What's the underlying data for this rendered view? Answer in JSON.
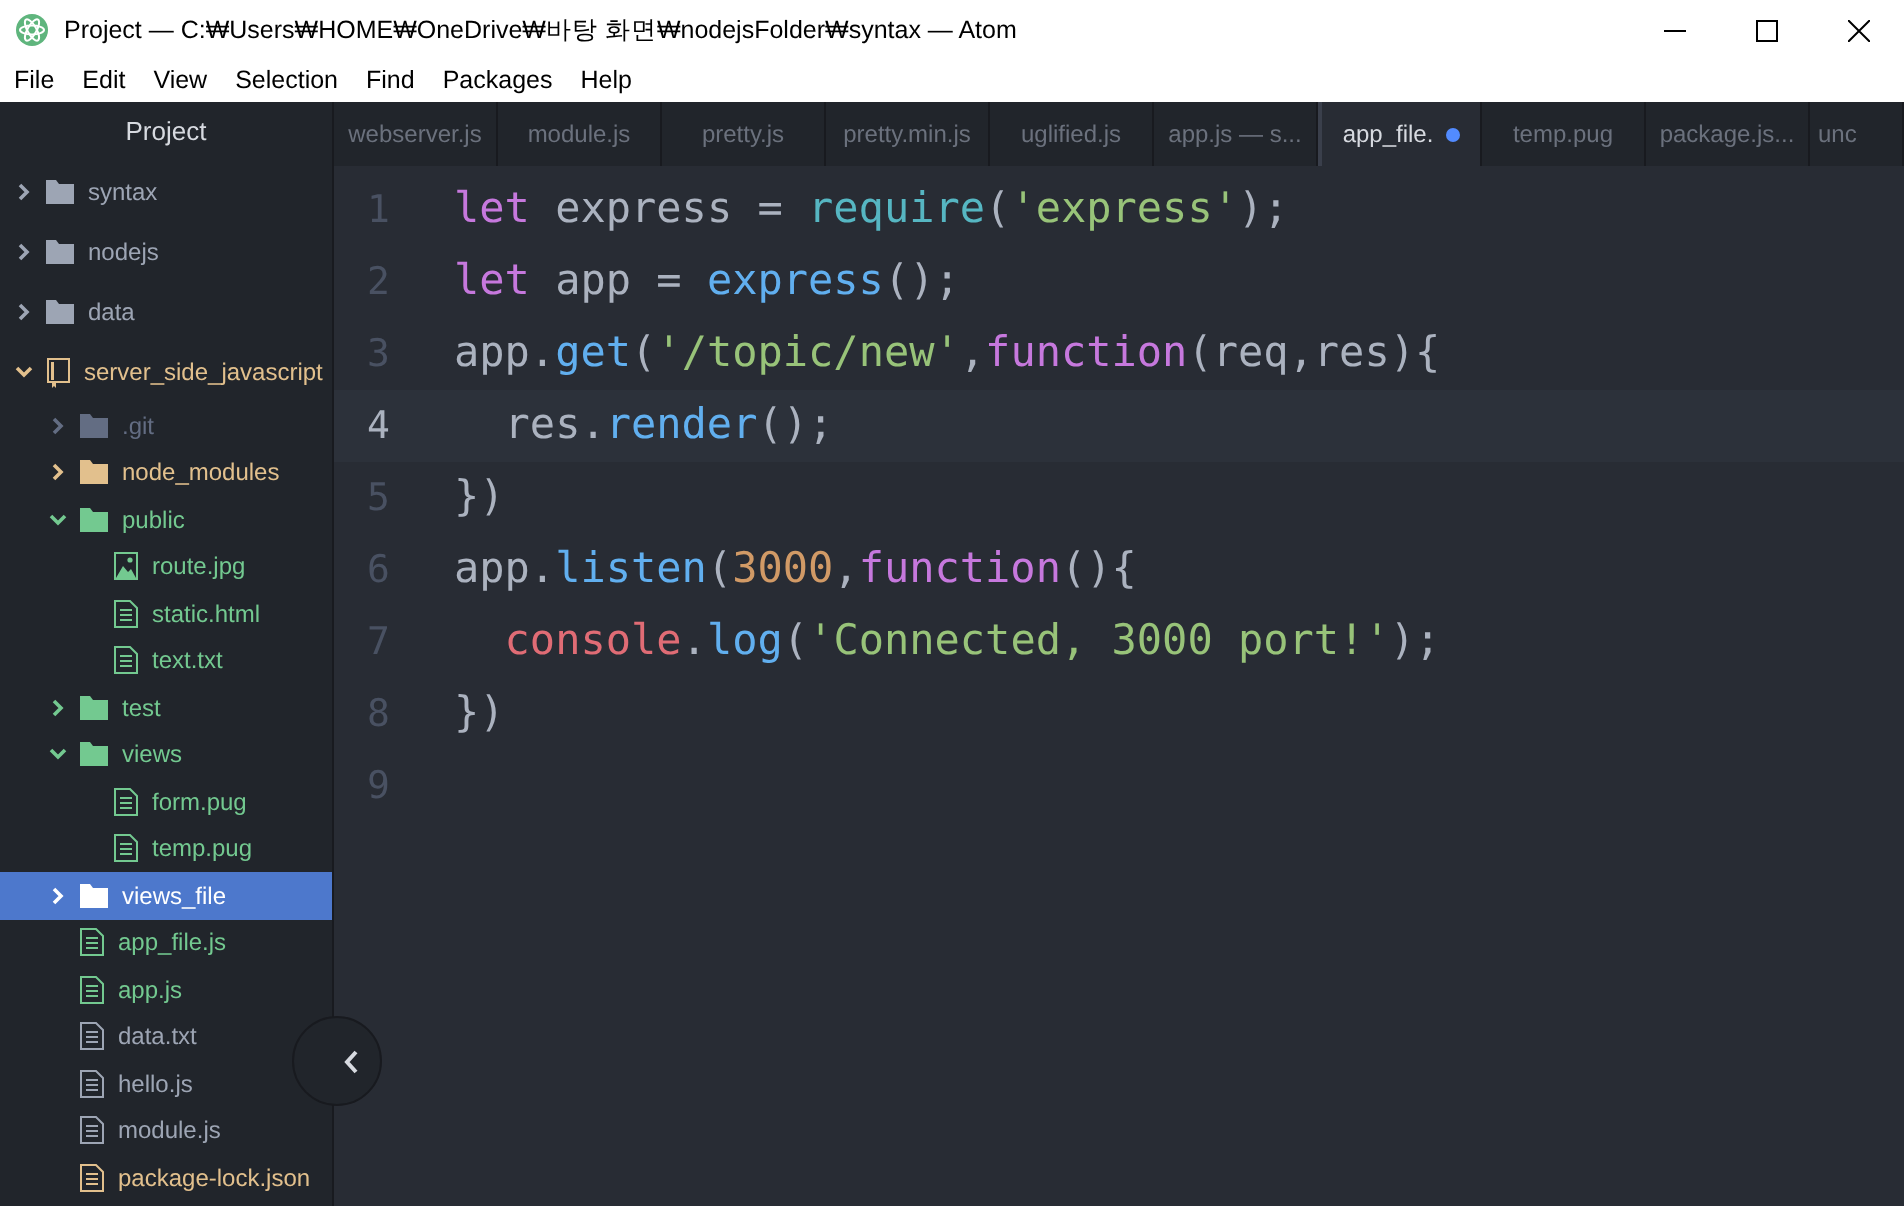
{
  "window": {
    "title": "Project — C:₩Users₩HOME₩OneDrive₩바탕 화면₩nodejsFolder₩syntax — Atom"
  },
  "menu": [
    "File",
    "Edit",
    "View",
    "Selection",
    "Find",
    "Packages",
    "Help"
  ],
  "tree_view": {
    "title": "Project",
    "items": [
      {
        "label": "syntax",
        "kind": "folder",
        "expanded": false,
        "selected": false
      },
      {
        "label": "nodejs",
        "kind": "folder",
        "expanded": false,
        "selected": false
      },
      {
        "label": "data",
        "kind": "folder",
        "expanded": false,
        "selected": false
      },
      {
        "label": "server_side_javascript",
        "kind": "repo",
        "expanded": true,
        "selected": false,
        "color": "#e2c08d",
        "children": [
          {
            "label": ".git",
            "kind": "folder",
            "expanded": false,
            "selected": false,
            "color": "#636d83"
          },
          {
            "label": "node_modules",
            "kind": "folder",
            "expanded": false,
            "selected": false,
            "color": "#e2c08d"
          },
          {
            "label": "public",
            "kind": "folder",
            "expanded": true,
            "selected": false,
            "color": "#73c990",
            "children": [
              {
                "label": "route.jpg",
                "kind": "image",
                "selected": false,
                "color": "#73c990"
              },
              {
                "label": "static.html",
                "kind": "file",
                "selected": false,
                "color": "#73c990"
              },
              {
                "label": "text.txt",
                "kind": "file",
                "selected": false,
                "color": "#73c990"
              }
            ]
          },
          {
            "label": "test",
            "kind": "folder",
            "expanded": false,
            "selected": false,
            "color": "#73c990"
          },
          {
            "label": "views",
            "kind": "folder",
            "expanded": true,
            "selected": false,
            "color": "#73c990",
            "children": [
              {
                "label": "form.pug",
                "kind": "file",
                "selected": false,
                "color": "#73c990"
              },
              {
                "label": "temp.pug",
                "kind": "file",
                "selected": false,
                "color": "#73c990"
              }
            ]
          },
          {
            "label": "views_file",
            "kind": "folder",
            "expanded": false,
            "selected": true
          },
          {
            "label": "app_file.js",
            "kind": "file",
            "selected": false,
            "color": "#73c990"
          },
          {
            "label": "app.js",
            "kind": "file",
            "selected": false,
            "color": "#73c990"
          },
          {
            "label": "data.txt",
            "kind": "file",
            "selected": false
          },
          {
            "label": "hello.js",
            "kind": "file",
            "selected": false
          },
          {
            "label": "module.js",
            "kind": "file",
            "selected": false
          },
          {
            "label": "package-lock.json",
            "kind": "file",
            "selected": false,
            "color": "#e2c08d"
          }
        ]
      }
    ]
  },
  "tabs": [
    {
      "label": "webserver.js",
      "selected": false,
      "modified": false
    },
    {
      "label": "module.js",
      "selected": false,
      "modified": false
    },
    {
      "label": "pretty.js",
      "selected": false,
      "modified": false
    },
    {
      "label": "pretty.min.js",
      "selected": false,
      "modified": false
    },
    {
      "label": "uglified.js",
      "selected": false,
      "modified": false
    },
    {
      "label": "app.js — s...",
      "selected": false,
      "modified": false
    },
    {
      "label": "app_file.",
      "selected": true,
      "modified": true
    },
    {
      "label": "temp.pug",
      "selected": false,
      "modified": false
    },
    {
      "label": "package.js...",
      "selected": false,
      "modified": false
    },
    {
      "label": "unc",
      "selected": false,
      "modified": false
    }
  ],
  "editor": {
    "lines": [
      {
        "number": "1",
        "current": false,
        "tokens": [
          {
            "text": "let",
            "kind": "keyword"
          },
          {
            "text": " express = ",
            "kind": "plain"
          },
          {
            "text": "require",
            "kind": "support"
          },
          {
            "text": "(",
            "kind": "plain"
          },
          {
            "text": "'express'",
            "kind": "string"
          },
          {
            "text": ");",
            "kind": "plain"
          }
        ]
      },
      {
        "number": "2",
        "current": false,
        "tokens": [
          {
            "text": "let",
            "kind": "keyword"
          },
          {
            "text": " app = ",
            "kind": "plain"
          },
          {
            "text": "express",
            "kind": "function"
          },
          {
            "text": "();",
            "kind": "plain"
          }
        ]
      },
      {
        "number": "3",
        "current": false,
        "tokens": [
          {
            "text": "app.",
            "kind": "plain"
          },
          {
            "text": "get",
            "kind": "function"
          },
          {
            "text": "(",
            "kind": "plain"
          },
          {
            "text": "'/topic/new'",
            "kind": "string"
          },
          {
            "text": ",",
            "kind": "plain"
          },
          {
            "text": "function",
            "kind": "keyword"
          },
          {
            "text": "(req,res){",
            "kind": "plain"
          }
        ]
      },
      {
        "number": "4",
        "current": true,
        "tokens": [
          {
            "text": "  res.",
            "kind": "plain"
          },
          {
            "text": "render",
            "kind": "function"
          },
          {
            "text": "();",
            "kind": "plain"
          }
        ]
      },
      {
        "number": "5",
        "current": false,
        "tokens": [
          {
            "text": "})",
            "kind": "plain"
          }
        ]
      },
      {
        "number": "6",
        "current": false,
        "tokens": [
          {
            "text": "app.",
            "kind": "plain"
          },
          {
            "text": "listen",
            "kind": "function"
          },
          {
            "text": "(",
            "kind": "plain"
          },
          {
            "text": "3000",
            "kind": "number"
          },
          {
            "text": ",",
            "kind": "plain"
          },
          {
            "text": "function",
            "kind": "keyword"
          },
          {
            "text": "(){",
            "kind": "plain"
          }
        ]
      },
      {
        "number": "7",
        "current": false,
        "tokens": [
          {
            "text": "  console",
            "kind": "variable"
          },
          {
            "text": ".",
            "kind": "plain"
          },
          {
            "text": "log",
            "kind": "function"
          },
          {
            "text": "(",
            "kind": "plain"
          },
          {
            "text": "'Connected, 3000 port!'",
            "kind": "string"
          },
          {
            "text": ");",
            "kind": "plain"
          }
        ]
      },
      {
        "number": "8",
        "current": false,
        "tokens": [
          {
            "text": "})",
            "kind": "plain"
          }
        ]
      },
      {
        "number": "9",
        "current": false
      }
    ]
  }
}
